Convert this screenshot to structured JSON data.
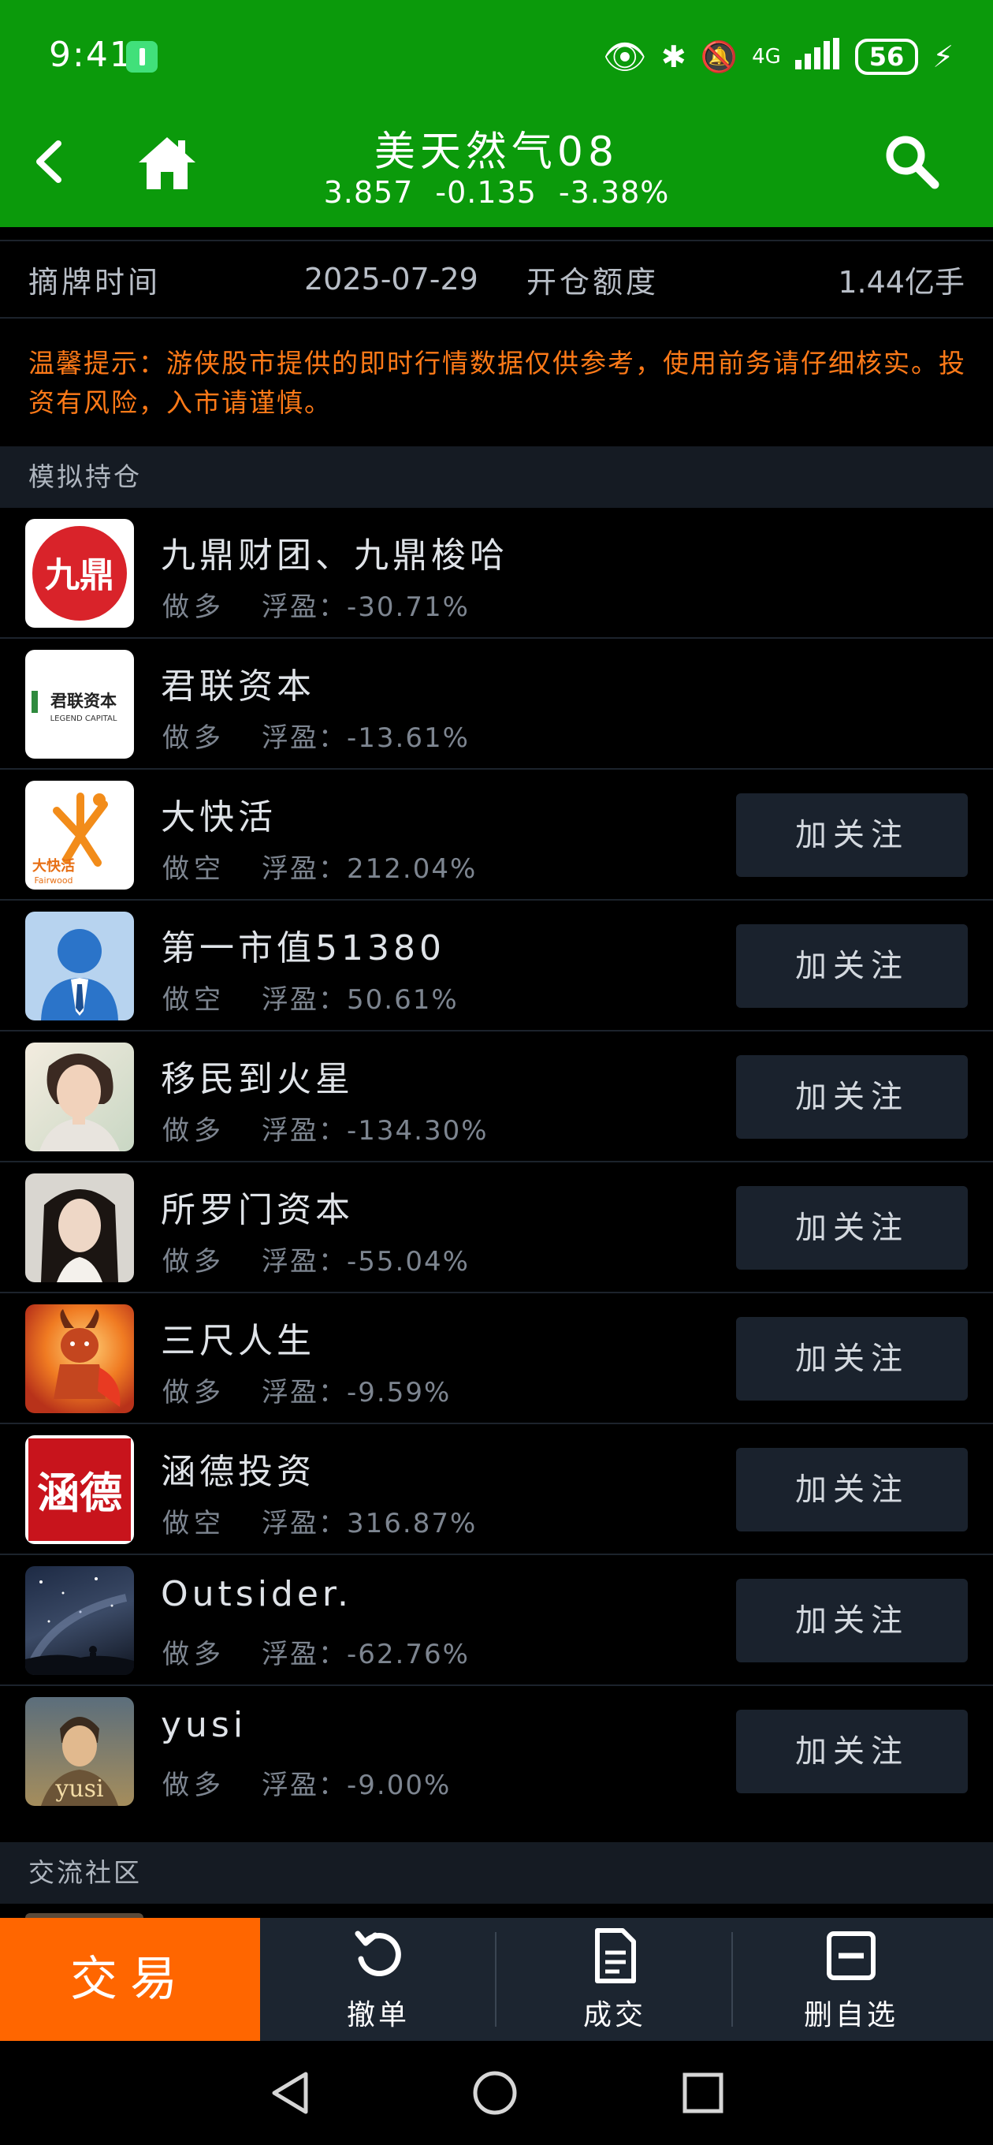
{
  "status_bar": {
    "time": "9:41",
    "network": "4G",
    "battery": "56"
  },
  "header": {
    "title": "美天然气08",
    "price": "3.857",
    "change": "-0.135",
    "change_pct": "-3.38%"
  },
  "info": {
    "delist_label": "摘牌时间",
    "delist_value": "2025-07-29",
    "open_label": "开仓额度",
    "open_value": "1.44亿手"
  },
  "notice": "温馨提示：游侠股市提供的即时行情数据仅供参考，使用前务请仔细核实。投资有风险，入市请谨慎。",
  "sections": {
    "positions": "模拟持仓",
    "community": "交流社区"
  },
  "float_label": "浮盈：",
  "follow_label": "加关注",
  "positions": [
    {
      "name": "九鼎财团、九鼎梭哈",
      "direction": "做多",
      "float": "-30.71%",
      "follow": false
    },
    {
      "name": "君联资本",
      "direction": "做多",
      "float": "-13.61%",
      "follow": false
    },
    {
      "name": "大快活",
      "direction": "做空",
      "float": "212.04%",
      "follow": true
    },
    {
      "name": "第一市值51380",
      "direction": "做空",
      "float": "50.61%",
      "follow": true
    },
    {
      "name": "移民到火星",
      "direction": "做多",
      "float": "-134.30%",
      "follow": true
    },
    {
      "name": "所罗门资本",
      "direction": "做多",
      "float": "-55.04%",
      "follow": true
    },
    {
      "name": "三尺人生",
      "direction": "做多",
      "float": "-9.59%",
      "follow": true
    },
    {
      "name": "涵德投资",
      "direction": "做空",
      "float": "316.87%",
      "follow": true
    },
    {
      "name": "Outsider.",
      "direction": "做多",
      "float": "-62.76%",
      "follow": true
    },
    {
      "name": "yusi",
      "direction": "做多",
      "float": "-9.00%",
      "follow": true
    }
  ],
  "avatar_text": {
    "jiuding": "九鼎",
    "junlian_cn": "君联资本",
    "junlian_en": "LEGEND CAPITAL",
    "fairwood_cn": "大快活",
    "fairwood_en": "Fairwood",
    "hande": "涵德",
    "yusi": "yusi"
  },
  "tabbar": {
    "trade": "交易",
    "cancel": "撤单",
    "deals": "成交",
    "remove": "删自选"
  },
  "colors": {
    "brand_green": "#0b9a0b",
    "accent_orange": "#ff6600",
    "notice_orange": "#ff7a18"
  }
}
